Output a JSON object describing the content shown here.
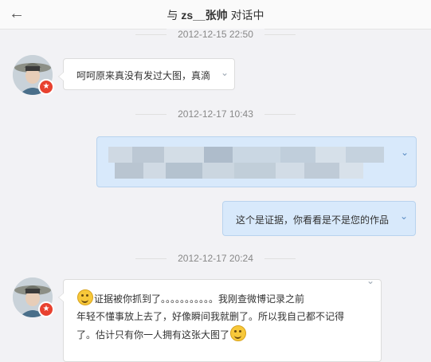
{
  "header": {
    "prefix": "与",
    "name": "zs__张帅",
    "suffix": "对话中",
    "back_icon": "arrow-left-icon"
  },
  "timestamps": [
    "2012-12-15 22:50",
    "2012-12-17 10:43",
    "2012-12-17 20:24"
  ],
  "messages": [
    {
      "sender": "other",
      "text": "呵呵原来真没有发过大图，真滴"
    },
    {
      "sender": "me",
      "text": "",
      "blurred": true
    },
    {
      "sender": "me",
      "text": "这个是证据，你看看是不是您的作品"
    },
    {
      "sender": "other",
      "line1": "证据被你抓到了。。。。。。。。。。。我刚查微博记录之前",
      "line2": "年轻不懂事放上去了，好像瞬间我就删了。所以我自己都不记得",
      "line3": "了。估计只有你一人拥有这张大图了"
    }
  ],
  "colors": {
    "bubble_me": "#d8e9fb",
    "bubble_other": "#ffffff",
    "badge": "#e8412f",
    "background": "#f2f2f5"
  },
  "icons": {
    "message_menu": "chevron-down-icon",
    "avatar_badge": "verified-badge-icon",
    "emoji_1": "cry-emoji-icon",
    "emoji_2": "grin-emoji-icon"
  }
}
